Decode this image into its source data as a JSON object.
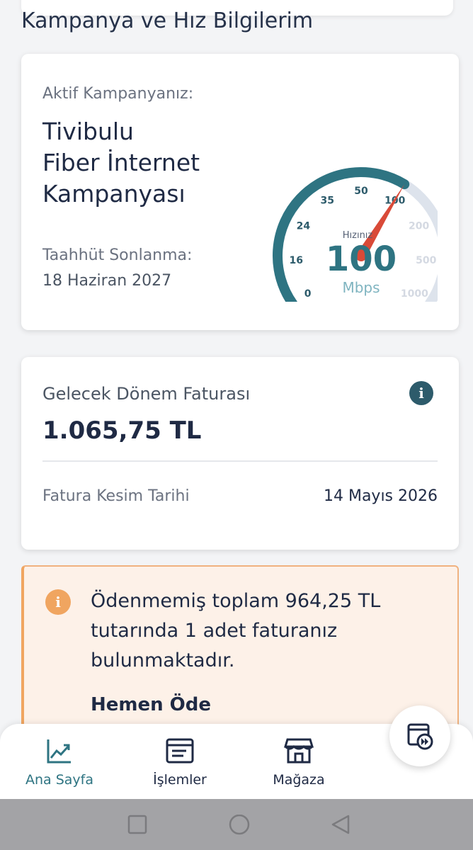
{
  "section": {
    "title": "Kampanya ve Hız Bilgilerim"
  },
  "campaign": {
    "active_label": "Aktif Kampanyanız:",
    "name_lines": [
      "Tivibulu",
      "Fiber İnternet",
      "Kampanyası"
    ],
    "commitment_label": "Taahhüt Sonlanma:",
    "commitment_date": "18 Haziran 2027"
  },
  "speed_gauge": {
    "ticks": [
      "0",
      "16",
      "24",
      "35",
      "50",
      "100",
      "200",
      "500",
      "1000"
    ],
    "active_ticks": 6,
    "caption": "Hızınız",
    "value": "100",
    "unit": "Mbps",
    "accent_color": "#2e7482",
    "needle_color": "#d94a38",
    "track_color": "#dde3ec"
  },
  "bill": {
    "next_label": "Gelecek Dönem Faturası",
    "next_amount": "1.065,75 TL",
    "info_icon": "i",
    "date_label": "Fatura Kesim Tarihi",
    "date_value": "14 Mayıs 2026"
  },
  "alert": {
    "icon": "i",
    "text": "Ödenmemiş toplam 964,25 TL tutarında 1 adet faturanız bulunmaktadır.",
    "action": "Hemen Öde",
    "color": "#f0a560"
  },
  "nav": {
    "items": [
      {
        "label": "Ana Sayfa",
        "icon": "chart-trend-icon",
        "active": true
      },
      {
        "label": "İşlemler",
        "icon": "list-doc-icon",
        "active": false
      },
      {
        "label": "Mağaza",
        "icon": "store-icon",
        "active": false
      }
    ],
    "fab_icon": "fast-forward-doc-icon"
  },
  "system_bar": {
    "buttons": [
      "recent-apps-icon",
      "home-circle-icon",
      "back-triangle-icon"
    ]
  }
}
